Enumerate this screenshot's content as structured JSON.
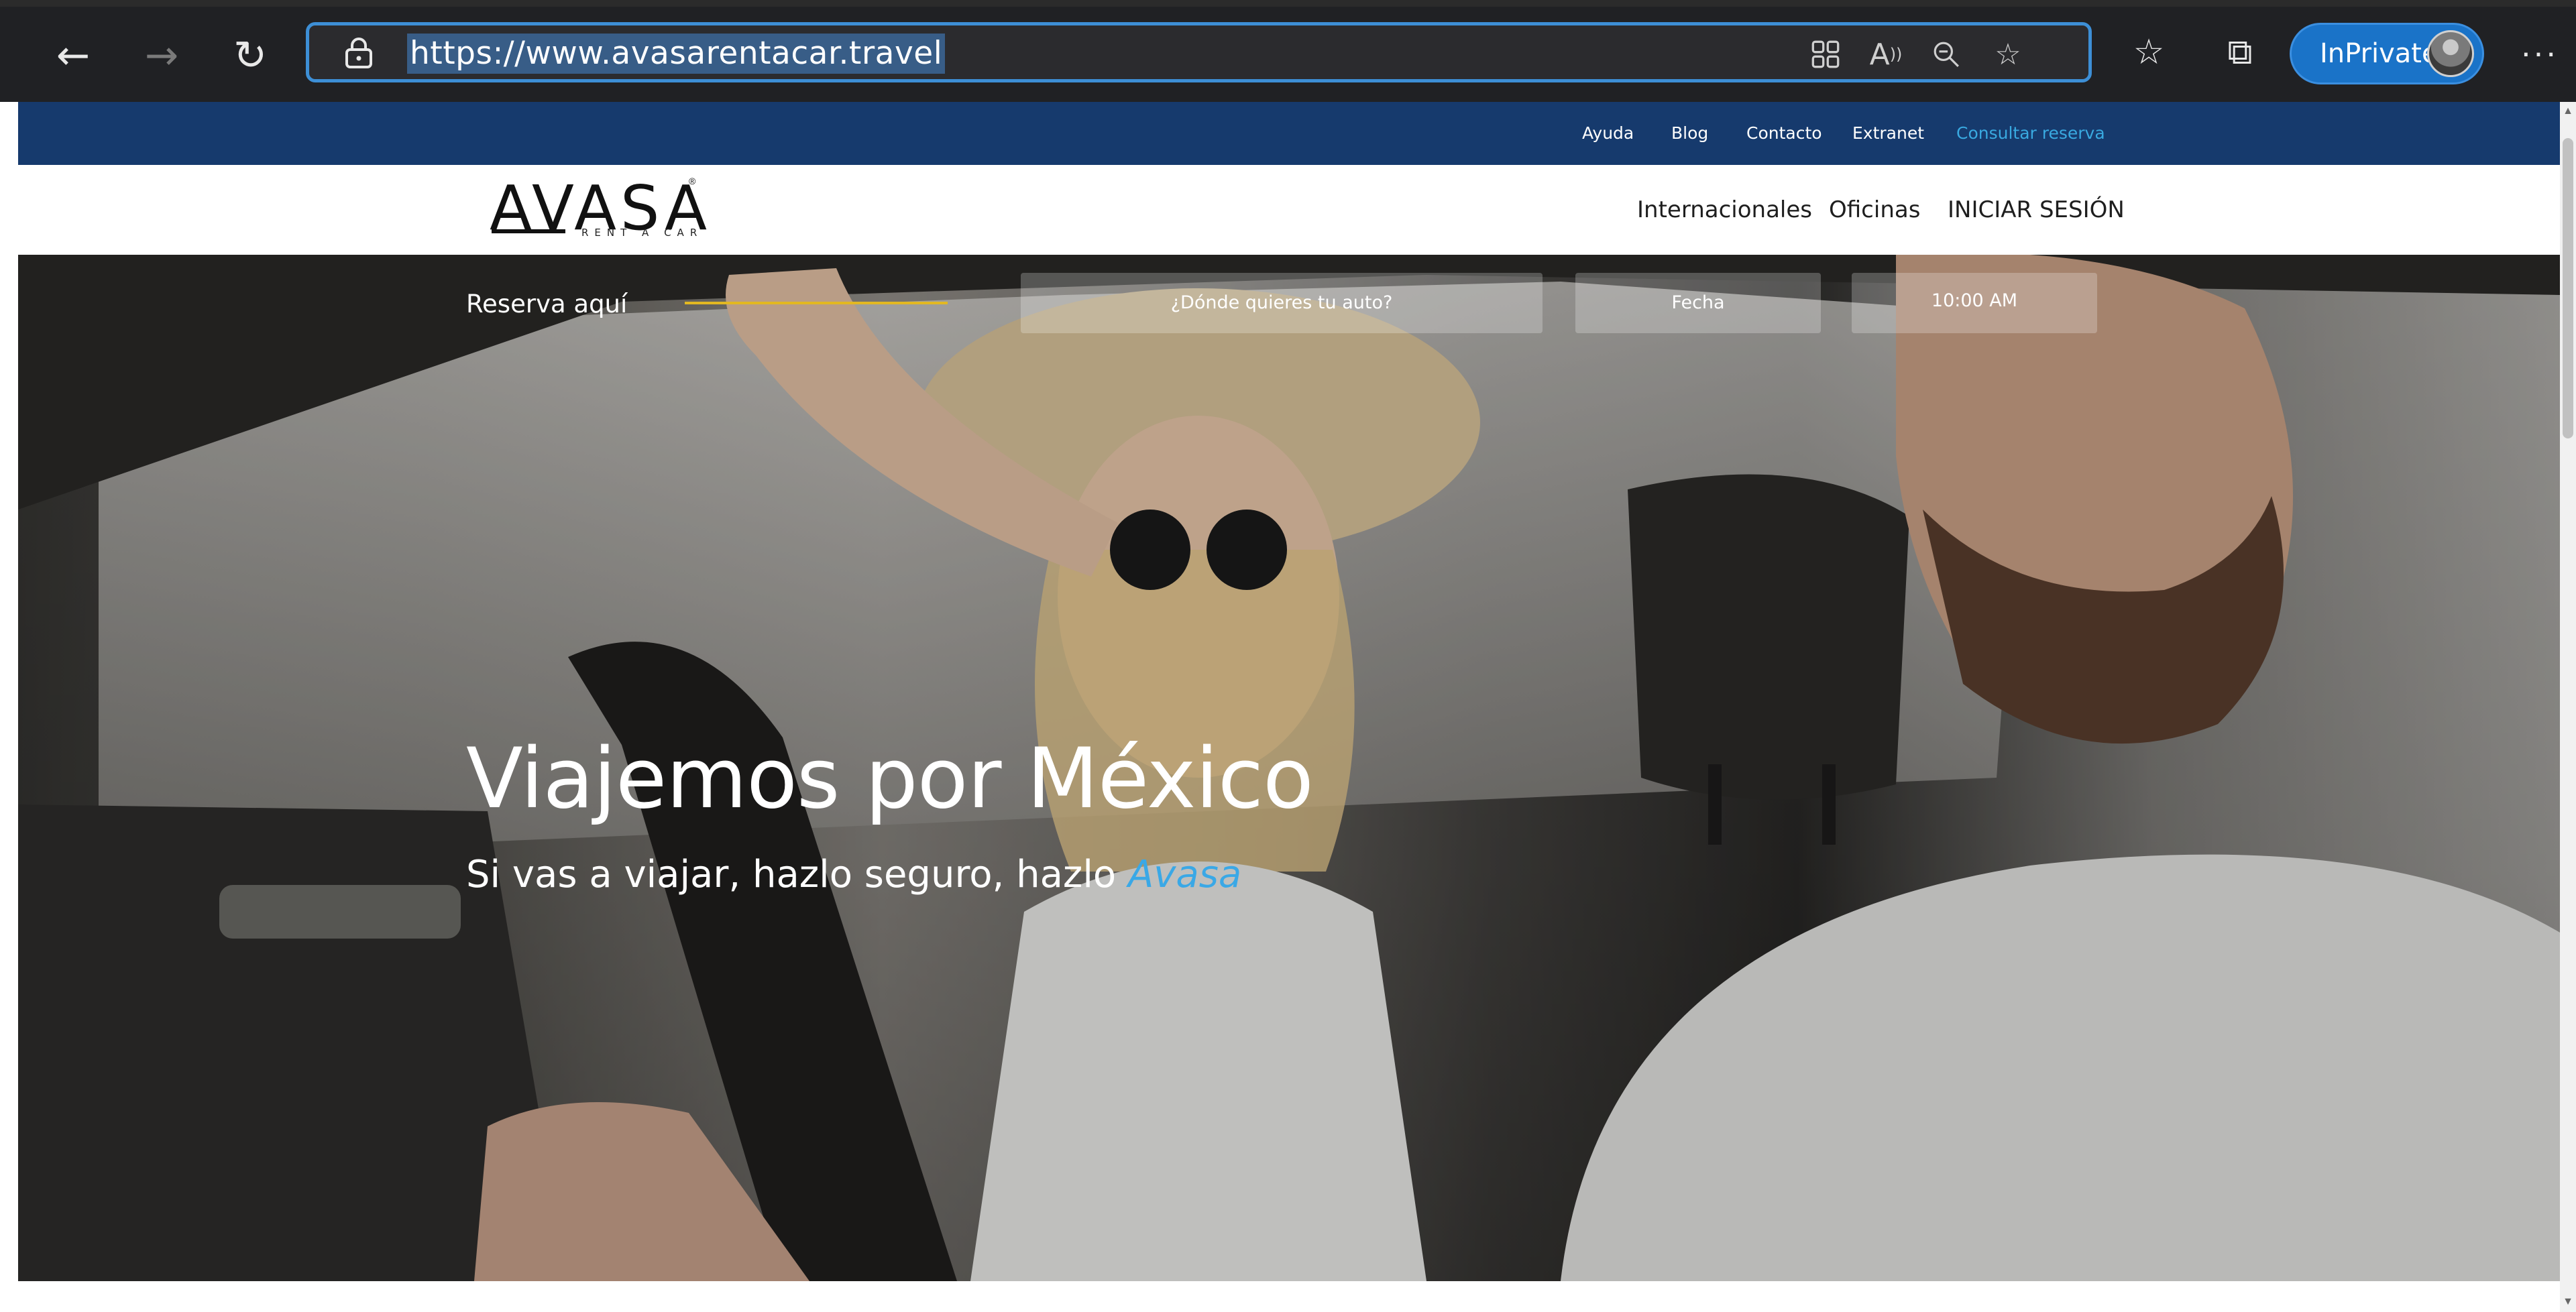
{
  "browser": {
    "url": "https://www.avasarentacar.travel",
    "inprivate_label": "InPrivate",
    "more_label": "···",
    "icons": [
      "back-icon",
      "forward-icon",
      "refresh-icon",
      "lock-icon",
      "app-grid-icon",
      "read-aloud-icon",
      "zoom-out-icon",
      "add-favorite-icon",
      "favorites-icon",
      "collections-icon",
      "profile-avatar"
    ]
  },
  "topbar": {
    "links": [
      "Ayuda",
      "Blog",
      "Contacto",
      "Extranet",
      "Consultar reserva"
    ],
    "accent_color": "#39a9e0",
    "background": "#163a6d"
  },
  "header": {
    "logo_text": "AVASA",
    "logo_sub": "RENT A CAR",
    "logo_reg": "®",
    "nav": [
      "Internacionales",
      "Oficinas",
      "INICIAR SESIÓN"
    ]
  },
  "booking": {
    "label": "Reserva aquí",
    "location_placeholder": "¿Dónde quieres tu auto?",
    "date_placeholder": "Fecha",
    "time_value": "10:00 AM"
  },
  "hero": {
    "title": "Viajemos por México",
    "subtitle": "Si vas a viajar, hazlo seguro, hazlo",
    "brand": "Avasa",
    "brand_color": "#3aa8e6"
  }
}
